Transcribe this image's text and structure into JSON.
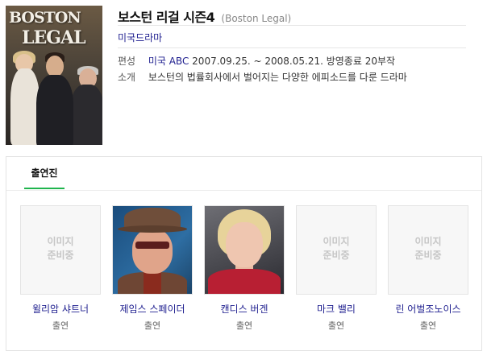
{
  "show": {
    "title": "보스턴 리걸 시즌4",
    "original_title": "(Boston Legal)",
    "genre": "미국드라마",
    "poster": {
      "title_line1": "BOSTON",
      "title_line2": "LEGAL"
    }
  },
  "info": {
    "broadcast_label": "편성",
    "network": "미국 ABC",
    "broadcast_detail": "2007.09.25. ~ 2008.05.21. 방영종료 20부작",
    "intro_label": "소개",
    "intro_text": "보스턴의 법률회사에서 벌어지는 다양한 에피소드를 다룬 드라마"
  },
  "cast_section": {
    "tab_label": "출연진",
    "accent_color": "#1fb44d",
    "placeholder_line1": "이미지",
    "placeholder_line2": "준비중",
    "members": [
      {
        "name": "윌리암 샤트너",
        "role": "출연",
        "photo": "placeholder"
      },
      {
        "name": "제임스 스페이더",
        "role": "출연",
        "photo": "actor-photo"
      },
      {
        "name": "캔디스 버겐",
        "role": "출연",
        "photo": "actress-photo"
      },
      {
        "name": "마크 밸리",
        "role": "출연",
        "photo": "placeholder"
      },
      {
        "name": "린 어벌조노이스",
        "role": "출연",
        "photo": "placeholder"
      }
    ]
  },
  "colors": {
    "link": "#1f1f8f",
    "border": "#e3e3e3"
  }
}
